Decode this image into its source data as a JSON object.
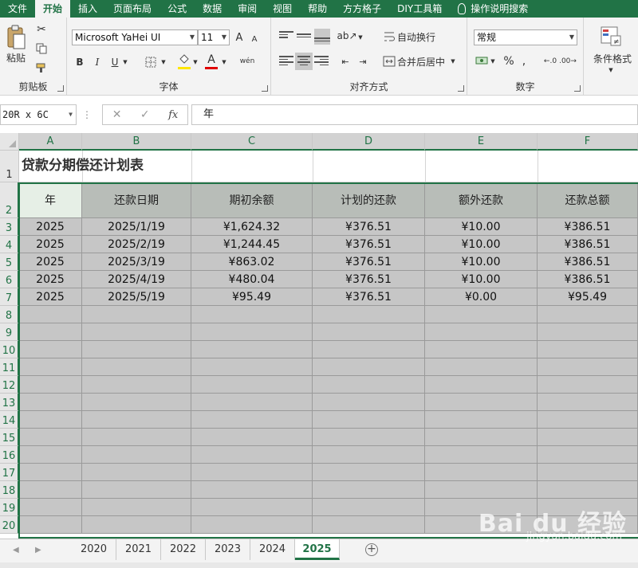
{
  "menu": {
    "tabs": [
      "文件",
      "开始",
      "插入",
      "页面布局",
      "公式",
      "数据",
      "审阅",
      "视图",
      "帮助",
      "方方格子",
      "DIY工具箱"
    ],
    "active": "开始",
    "tell_me": "操作说明搜索"
  },
  "ribbon": {
    "clipboard": {
      "label": "剪贴板",
      "paste": "粘贴"
    },
    "font": {
      "label": "字体",
      "name": "Microsoft YaHei UI",
      "size": "11",
      "grow": "A",
      "shrink": "A",
      "bold": "B",
      "italic": "I",
      "underline": "U",
      "phonetic": "wén",
      "color_letter": "A"
    },
    "alignment": {
      "label": "对齐方式",
      "wrap": "自动换行",
      "merge": "合并后居中"
    },
    "number": {
      "label": "数字",
      "format": "常规",
      "percent": "%"
    },
    "styles": {
      "conditional": "条件格式"
    }
  },
  "formula_bar": {
    "name_box": "20R x 6C",
    "fx": "fx",
    "content": "年"
  },
  "sheet": {
    "columns": [
      "A",
      "B",
      "C",
      "D",
      "E",
      "F"
    ],
    "title": "贷款分期偿还计划表",
    "headers": [
      "年",
      "还款日期",
      "期初余额",
      "计划的还款",
      "额外还款",
      "还款总额"
    ],
    "rows": [
      [
        "2025",
        "2025/1/19",
        "¥1,624.32",
        "¥376.51",
        "¥10.00",
        "¥386.51"
      ],
      [
        "2025",
        "2025/2/19",
        "¥1,244.45",
        "¥376.51",
        "¥10.00",
        "¥386.51"
      ],
      [
        "2025",
        "2025/3/19",
        "¥863.02",
        "¥376.51",
        "¥10.00",
        "¥386.51"
      ],
      [
        "2025",
        "2025/4/19",
        "¥480.04",
        "¥376.51",
        "¥10.00",
        "¥386.51"
      ],
      [
        "2025",
        "2025/5/19",
        "¥95.49",
        "¥376.51",
        "¥0.00",
        "¥95.49"
      ]
    ],
    "row_numbers": [
      "1",
      "2",
      "3",
      "4",
      "5",
      "6",
      "7",
      "8",
      "9",
      "10",
      "11",
      "12",
      "13",
      "14",
      "15",
      "16",
      "17",
      "18",
      "19",
      "20"
    ]
  },
  "sheet_tabs": {
    "tabs": [
      "2020",
      "2021",
      "2022",
      "2023",
      "2024",
      "2025"
    ],
    "active": "2025"
  },
  "watermark": {
    "logo": "Bai du 经验",
    "sub": "jingyan.baidu.com"
  },
  "colors": {
    "accent": "#217346",
    "selection": "#c6c6c6"
  }
}
